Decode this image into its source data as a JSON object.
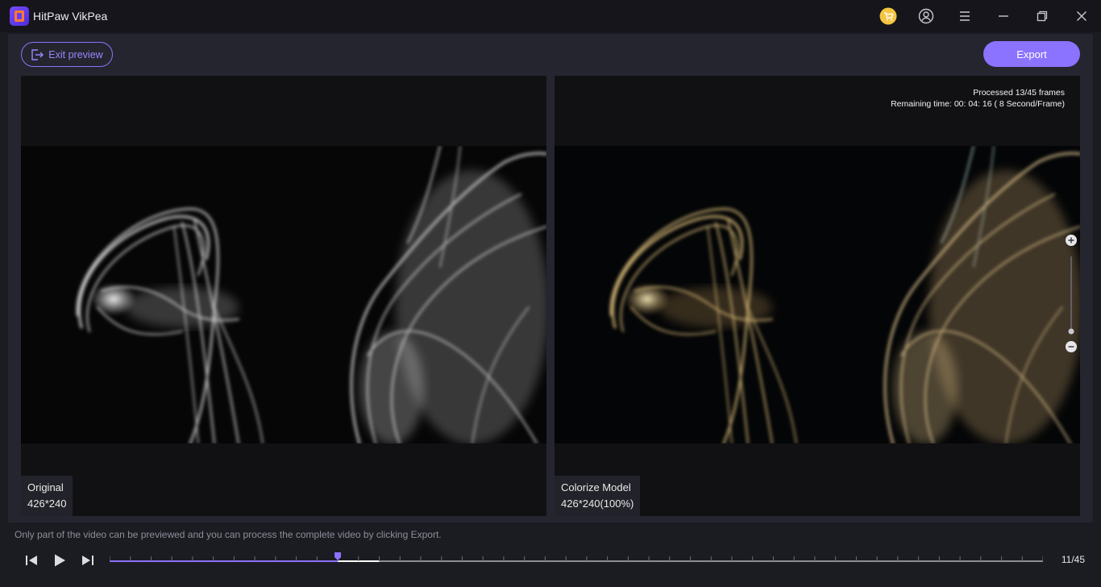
{
  "app": {
    "title": "HitPaw VikPea"
  },
  "titlebar": {
    "icons": [
      "cart-icon",
      "account-icon",
      "menu-icon",
      "minimize-icon",
      "restore-icon",
      "close-icon"
    ],
    "cart_color": "#f5c542"
  },
  "toolbar": {
    "exit_label": "Exit preview",
    "export_label": "Export"
  },
  "preview": {
    "original": {
      "label": "Original",
      "resolution": "426*240"
    },
    "processed": {
      "label": "Colorize Model",
      "resolution": "426*240(100%)"
    },
    "status_line1": "Processed 13/45 frames",
    "status_line2": "Remaining time: 00: 04: 16 ( 8 Second/Frame)"
  },
  "notice": "Only part of the video can be previewed and you can process the complete video by clicking Export.",
  "playback": {
    "frame_counter": "11/45",
    "current_frame": 11,
    "processed_frames": 13,
    "total_frames": 45
  },
  "colors": {
    "accent": "#8b73ff",
    "panel": "#25252f",
    "background": "#1b1b22"
  }
}
